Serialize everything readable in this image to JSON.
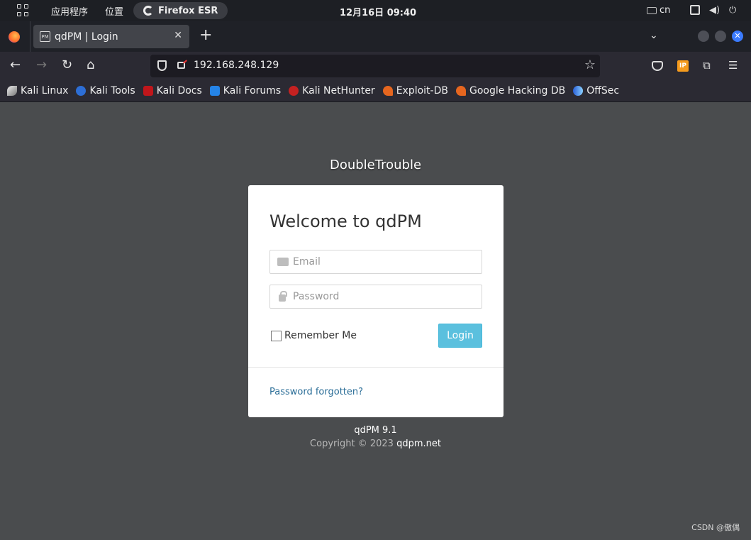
{
  "system_bar": {
    "menu_apps": "应用程序",
    "menu_places": "位置",
    "active_app": "Firefox ESR",
    "clock": "12月16日  09:40",
    "keyboard_layout": "cn"
  },
  "browser": {
    "tab_title": "qdPM | Login",
    "favicon_text": "PM",
    "url": "192.168.248.129",
    "bookmarks": [
      {
        "label": "Kali Linux",
        "icon": "kali-linux-icon"
      },
      {
        "label": "Kali Tools",
        "icon": "kali-tools-icon"
      },
      {
        "label": "Kali Docs",
        "icon": "kali-docs-icon"
      },
      {
        "label": "Kali Forums",
        "icon": "kali-forums-icon"
      },
      {
        "label": "Kali NetHunter",
        "icon": "kali-nethunter-icon"
      },
      {
        "label": "Exploit-DB",
        "icon": "exploit-db-icon"
      },
      {
        "label": "Google Hacking DB",
        "icon": "ghdb-icon"
      },
      {
        "label": "OffSec",
        "icon": "offsec-icon"
      }
    ],
    "ext_ip_label": "IP"
  },
  "page": {
    "brand": "DoubleTrouble",
    "heading": "Welcome to qdPM",
    "email_placeholder": "Email",
    "password_placeholder": "Password",
    "remember_label": "Remember Me",
    "login_label": "Login",
    "forgot_label": "Password forgotten?",
    "version": "qdPM 9.1",
    "copyright_prefix": "Copyright © 2023 ",
    "copyright_link": "qdpm.net"
  },
  "watermark": "CSDN @傲偶"
}
